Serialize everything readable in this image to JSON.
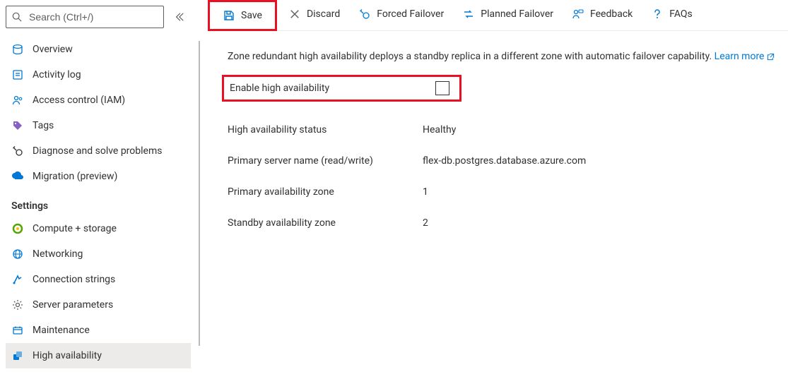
{
  "sidebar": {
    "search_placeholder": "Search (Ctrl+/)",
    "items": [
      {
        "label": "Overview"
      },
      {
        "label": "Activity log"
      },
      {
        "label": "Access control (IAM)"
      },
      {
        "label": "Tags"
      },
      {
        "label": "Diagnose and solve problems"
      },
      {
        "label": "Migration (preview)"
      }
    ],
    "settings_header": "Settings",
    "settings_items": [
      {
        "label": "Compute + storage"
      },
      {
        "label": "Networking"
      },
      {
        "label": "Connection strings"
      },
      {
        "label": "Server parameters"
      },
      {
        "label": "Maintenance"
      },
      {
        "label": "High availability"
      }
    ]
  },
  "toolbar": {
    "save": "Save",
    "discard": "Discard",
    "forced_failover": "Forced Failover",
    "planned_failover": "Planned Failover",
    "feedback": "Feedback",
    "faqs": "FAQs"
  },
  "main": {
    "description": "Zone redundant high availability deploys a standby replica in a different zone with automatic failover capability.",
    "learn_more": "Learn more",
    "enable_label": "Enable high availability",
    "rows": [
      {
        "key": "High availability status",
        "value": "Healthy"
      },
      {
        "key": "Primary server name (read/write)",
        "value": "flex-db.postgres.database.azure.com"
      },
      {
        "key": "Primary availability zone",
        "value": "1"
      },
      {
        "key": "Standby availability zone",
        "value": "2"
      }
    ]
  }
}
